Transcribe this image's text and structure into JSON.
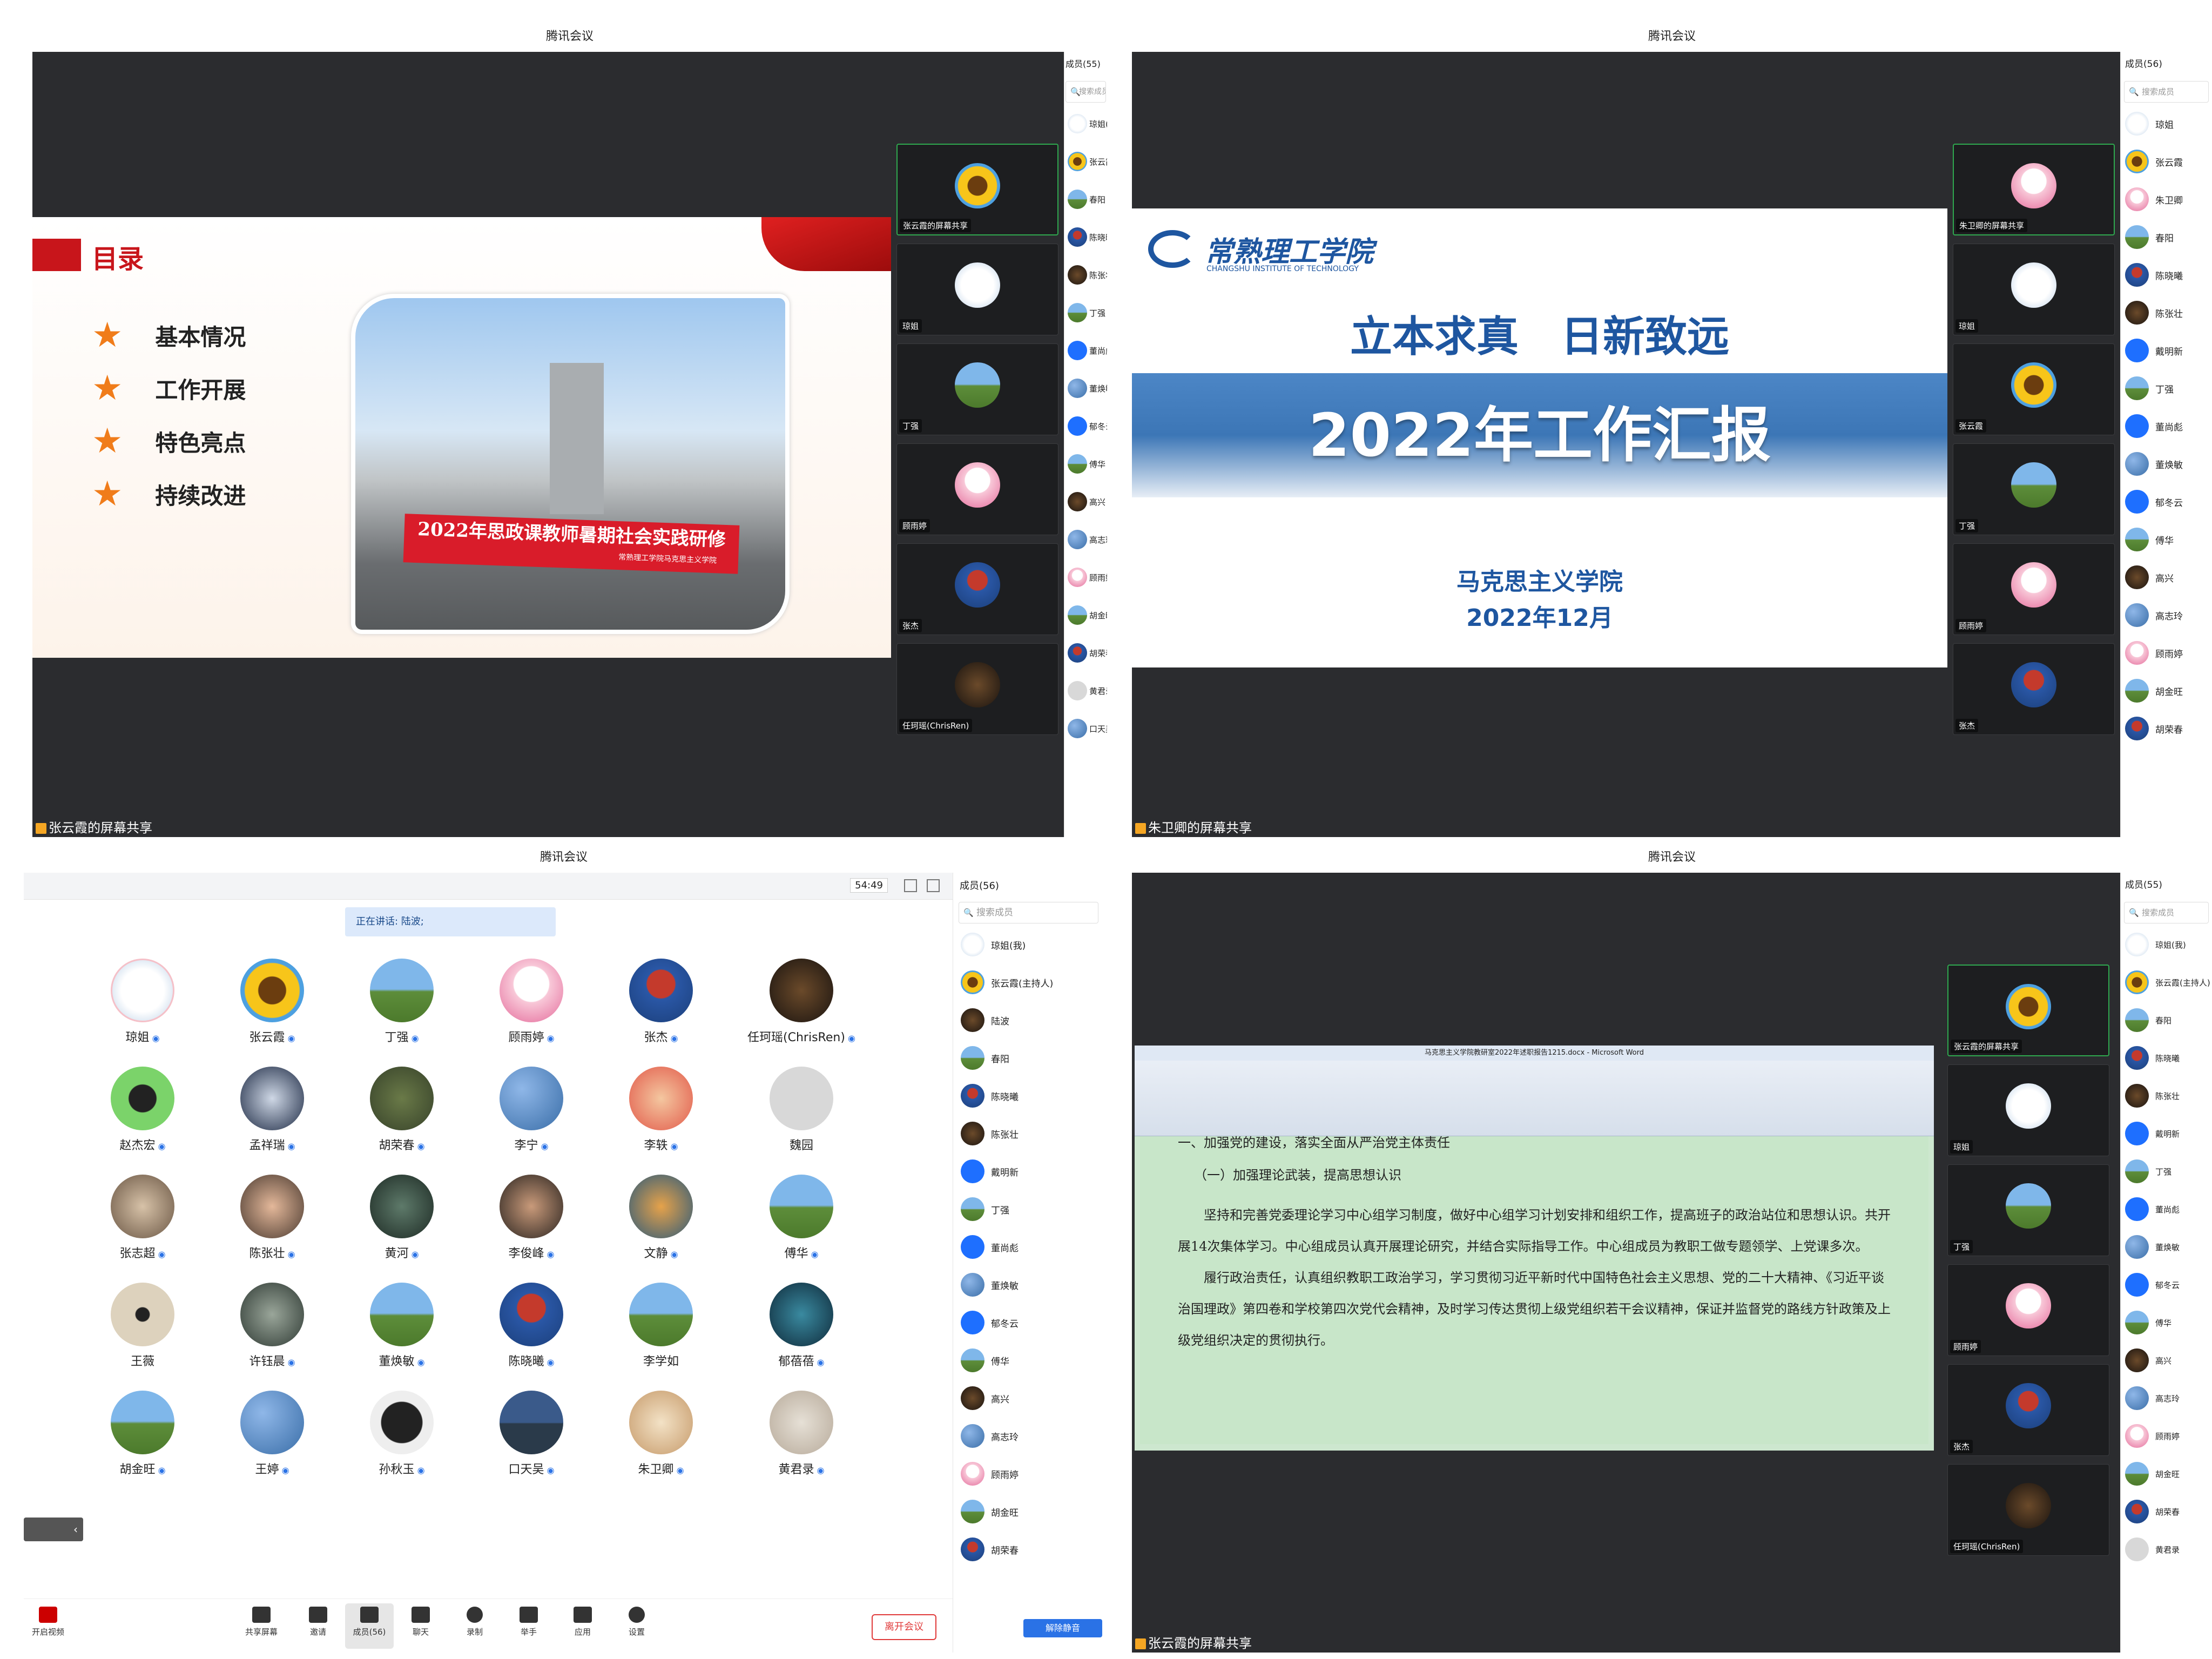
{
  "q1": {
    "title": "腾讯会议",
    "members_header": "成员(55)",
    "search_placeholder": "搜索成员",
    "share_label": "张云霞的屏幕共享",
    "slide": {
      "heading": "目录",
      "items": [
        "基本情况",
        "工作开展",
        "特色亮点",
        "持续改进"
      ],
      "banner": "2022年思政课教师暑期社会实践研修",
      "banner_sub": "常熟理工学院马克思主义学院"
    },
    "videos": [
      "张云霞的屏幕共享",
      "琼姐",
      "丁强",
      "顾雨婷",
      "张杰",
      "任珂瑶(ChrisRen)"
    ],
    "members": [
      "琼姐(我)",
      "张云霞(主持人)",
      "春阳",
      "陈晓曦",
      "陈张壮",
      "丁强",
      "董尚彪",
      "董焕敏",
      "郁冬云",
      "傅华",
      "高兴",
      "高志玲",
      "顾雨婷",
      "胡金旺",
      "胡荣春",
      "黄君录",
      "口天吴"
    ]
  },
  "q2": {
    "title": "腾讯会议",
    "members_header": "成员(56)",
    "search_placeholder": "搜索成员",
    "share_label": "朱卫卿的屏幕共享",
    "slide": {
      "school": "常熟理工学院",
      "school_en": "CHANGSHU INSTITUTE OF TECHNOLOGY",
      "motto": "立本求真　日新致远",
      "title": "2022年工作汇报",
      "dept": "马克思主义学院",
      "date": "2022年12月"
    },
    "videos": [
      "朱卫卿的屏幕共享",
      "琼姐",
      "张云霞",
      "丁强",
      "顾雨婷",
      "张杰"
    ],
    "members": [
      "琼姐",
      "张云霞",
      "朱卫卿",
      "春阳",
      "陈晓曦",
      "陈张壮",
      "戴明新",
      "丁强",
      "董尚彪",
      "董焕敏",
      "郁冬云",
      "傅华",
      "高兴",
      "高志玲",
      "顾雨婷",
      "胡金旺",
      "胡荣春"
    ]
  },
  "q3": {
    "title": "腾讯会议",
    "timer": "54:49",
    "speaking": "正在讲话: 陆波;",
    "members_header": "成员(56)",
    "search_placeholder": "搜索成员",
    "grid": [
      [
        "琼姐",
        "张云霞",
        "丁强",
        "顾雨婷",
        "张杰",
        "任珂瑶(ChrisRen)"
      ],
      [
        "赵杰宏",
        "孟祥瑞",
        "胡荣春",
        "李宁",
        "李轶",
        "魏园"
      ],
      [
        "张志超",
        "陈张壮",
        "黄河",
        "李俊峰",
        "文静",
        "傅华"
      ],
      [
        "王薇",
        "许钰晨",
        "董焕敏",
        "陈晓曦",
        "李学如",
        "郁蓓蓓"
      ],
      [
        "胡金旺",
        "王婷",
        "孙秋玉",
        "口天吴",
        "朱卫卿",
        "黄君录"
      ]
    ],
    "members": [
      "琼姐(我)",
      "张云霞(主持人)",
      "陆波",
      "春阳",
      "陈晓曦",
      "陈张壮",
      "戴明新",
      "丁强",
      "董尚彪",
      "董焕敏",
      "郁冬云",
      "傅华",
      "高兴",
      "高志玲",
      "顾雨婷",
      "胡金旺",
      "胡荣春"
    ],
    "toolbar": [
      "开启视频",
      "共享屏幕",
      "邀请",
      "成员(56)",
      "聊天",
      "录制",
      "举手",
      "应用",
      "设置"
    ],
    "leave": "离开会议",
    "unmute": "解除静音"
  },
  "q4": {
    "title": "腾讯会议",
    "members_header": "成员(55)",
    "search_placeholder": "搜索成员",
    "share_label": "张云霞的屏幕共享",
    "word_title": "马克思主义学院教研室2022年述职报告1215.docx - Microsoft Word",
    "doc": {
      "h1": "一、加强党的建设，落实全面从严治党主体责任",
      "h2": "（一）加强理论武装，提高思想认识",
      "p1": "坚持和完善党委理论学习中心组学习制度，做好中心组学习计划安排和组织工作，提高班子的政治站位和思想认识。共开展14次集体学习。中心组成员认真开展理论研究，并结合实际指导工作。中心组成员为教职工做专题领学、上党课多次。",
      "p2": "履行政治责任，认真组织教职工政治学习，学习贯彻习近平新时代中国特色社会主义思想、党的二十大精神、《习近平谈治国理政》第四卷和学校第四次党代会精神，及时学习传达贯彻上级党组织若干会议精神，保证并监督党的路线方针政策及上级党组织决定的贯彻执行。"
    },
    "videos": [
      "张云霞的屏幕共享",
      "琼姐",
      "丁强",
      "顾雨婷",
      "张杰",
      "任珂瑶(ChrisRen)"
    ],
    "members": [
      "琼姐(我)",
      "张云霞(主持人)",
      "春阳",
      "陈晓曦",
      "陈张壮",
      "戴明新",
      "丁强",
      "董尚彪",
      "董焕敏",
      "郁冬云",
      "傅华",
      "高兴",
      "高志玲",
      "顾雨婷",
      "胡金旺",
      "胡荣春",
      "黄君录"
    ]
  }
}
